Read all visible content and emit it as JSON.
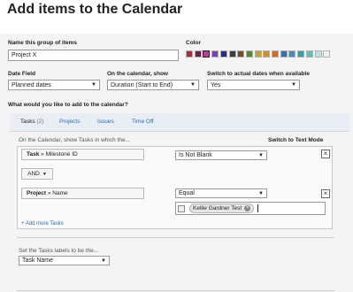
{
  "page": {
    "title": "Add items to the Calendar"
  },
  "form": {
    "name_label": "Name this group of items",
    "name_value": "Project X",
    "color_label": "Color",
    "date_field_label": "Date Field",
    "date_field_value": "Planned dates",
    "on_calendar_label": "On the calendar, show",
    "on_calendar_value": "Duration (Start to End)",
    "switch_label": "Switch to actual dates when available",
    "switch_value": "Yes",
    "what_label": "What would you like to add to the calendar?"
  },
  "colors": [
    "#b22a39",
    "#6e1f4b",
    "#c43a9a",
    "#7a3fb8",
    "#2c2c7a",
    "#3d3d3d",
    "#7a4a22",
    "#4f8a2c",
    "#caa22a",
    "#d98d20",
    "#d96b16",
    "#2f6fb5",
    "#3a8fc7",
    "#2fa3a3",
    "#5ec3b5",
    "#b9e1d9",
    "#f0f0f0"
  ],
  "tabs": [
    {
      "label": "Tasks",
      "count": "(2)"
    },
    {
      "label": "Projects"
    },
    {
      "label": "Issues"
    },
    {
      "label": "Time Off"
    }
  ],
  "filters": {
    "intro": "On the Calendar, show Tasks in which the...",
    "switch_link": "Switch to Text Mode",
    "row1_object": "Task",
    "row1_field": "» Milestone ID",
    "row1_operator": "Is Not Blank",
    "and_label": "AND",
    "row2_object": "Project",
    "row2_field": "» Name",
    "row2_operator": "Equal",
    "row2_token": "Kellie Gardner Test",
    "add_more": "+ Add more Tasks"
  },
  "labels": {
    "intro": "Set the Tasks labels to be the...",
    "value": "Task Name"
  }
}
